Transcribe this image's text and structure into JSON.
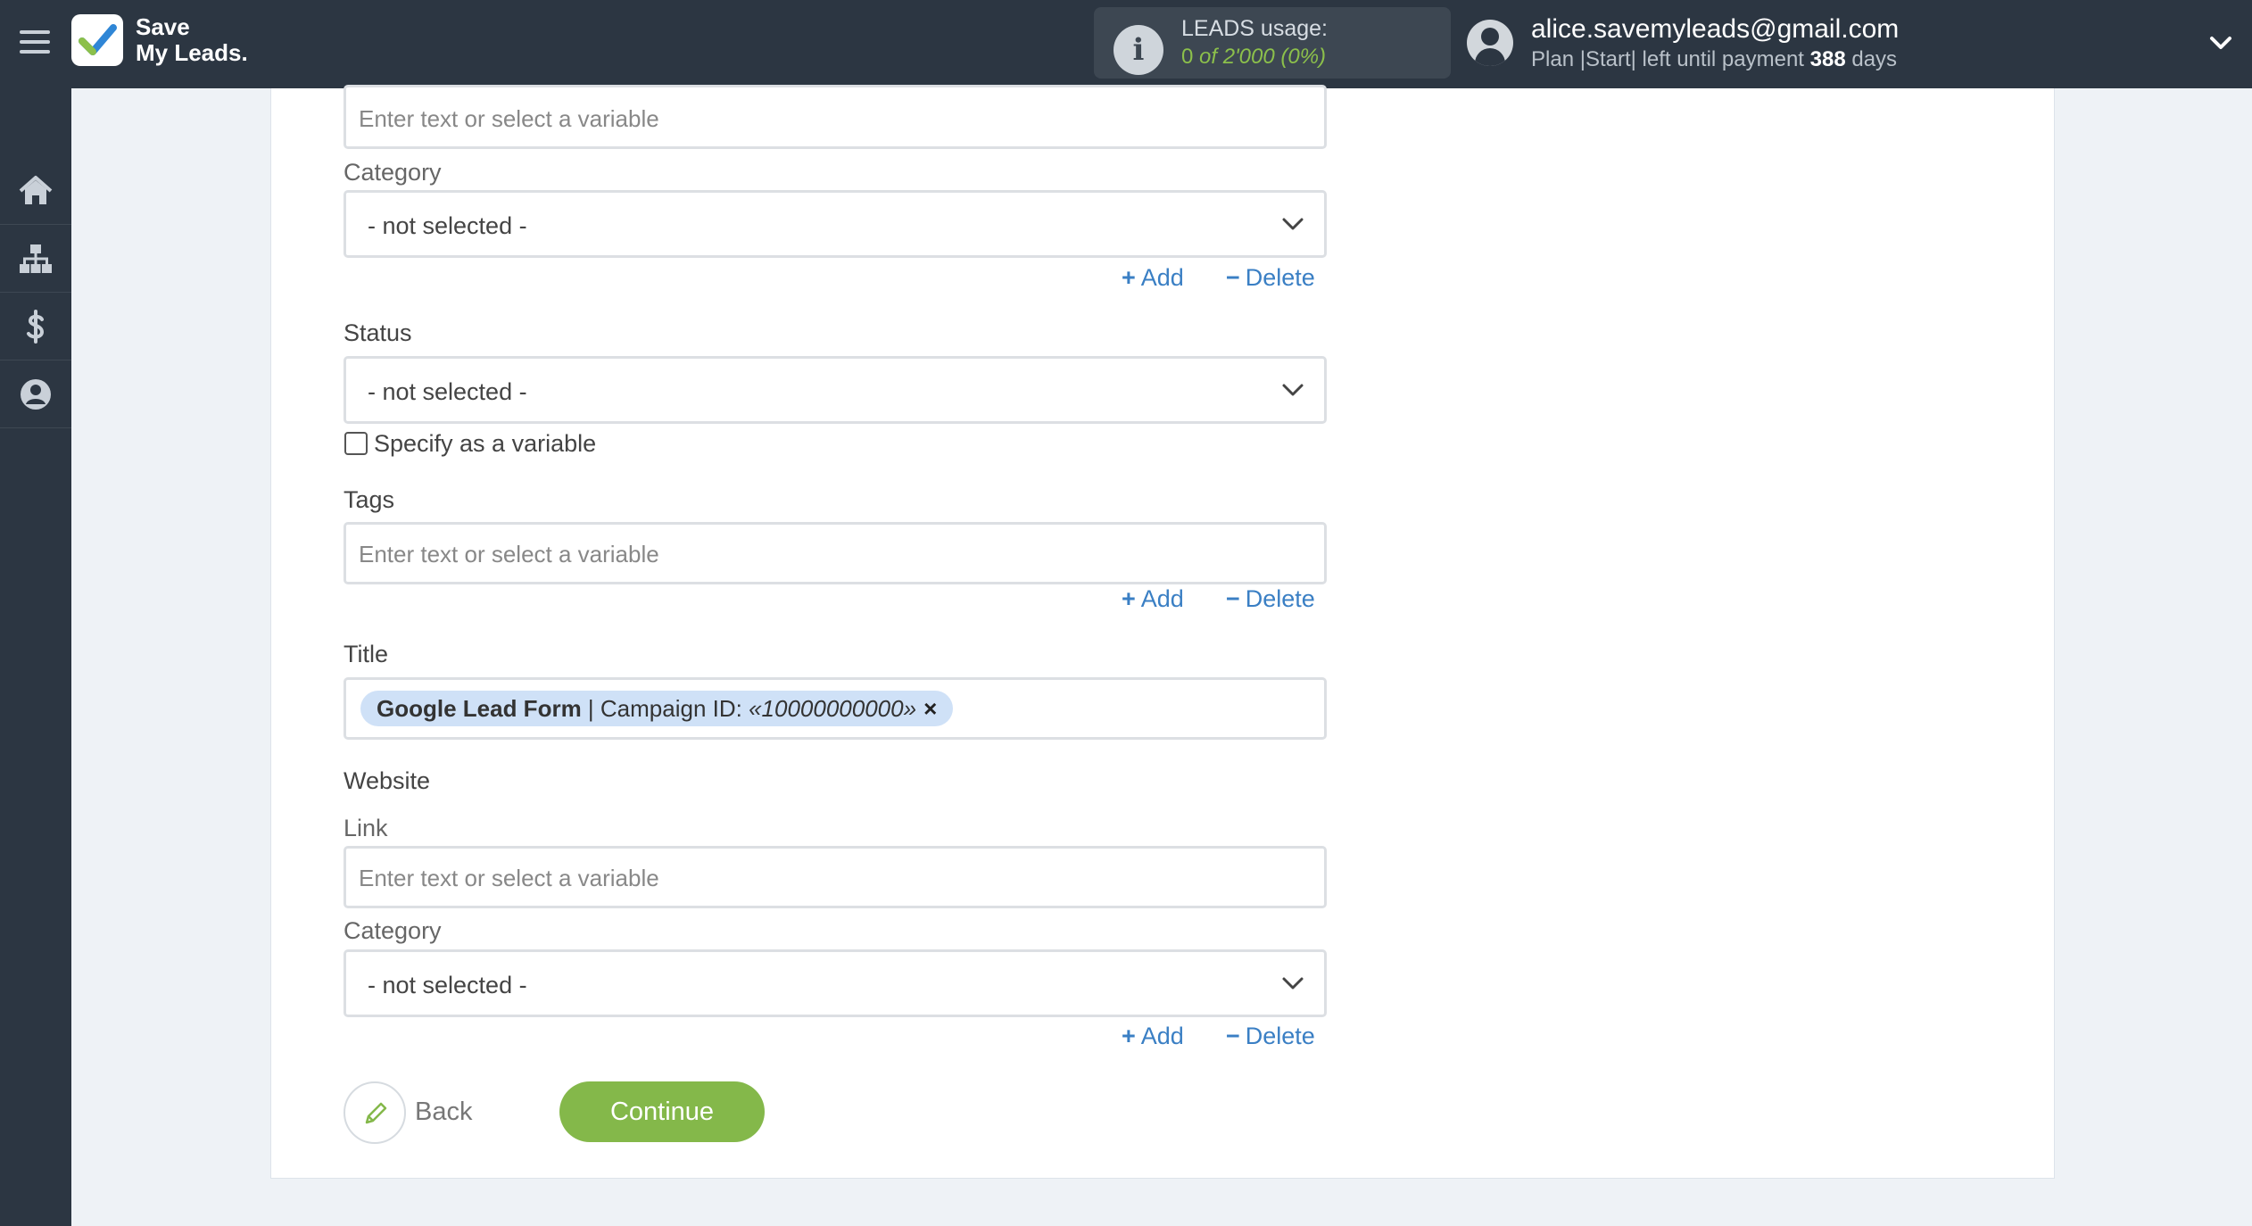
{
  "header": {
    "logo_line1": "Save",
    "logo_line2": "My Leads.",
    "usage_title": "LEADS usage:",
    "usage_used": "0",
    "usage_of": "of 2'000",
    "usage_percent": "(0%)",
    "email": "alice.savemyleads@gmail.com",
    "plan_prefix": "Plan |Start| left until payment",
    "plan_days": "388",
    "plan_suffix": "days"
  },
  "sidebar": {
    "items": [
      {
        "icon": "home-icon"
      },
      {
        "icon": "sitemap-icon"
      },
      {
        "icon": "dollar-icon"
      },
      {
        "icon": "user-icon"
      }
    ]
  },
  "form": {
    "top_input_placeholder": "Enter text or select a variable",
    "category1_label": "Category",
    "category1_value": "- not selected -",
    "add_label": "Add",
    "delete_label": "Delete",
    "status_label": "Status",
    "status_value": "- not selected -",
    "specify_variable_label": "Specify as a variable",
    "tags_label": "Tags",
    "tags_placeholder": "Enter text or select a variable",
    "title_label": "Title",
    "title_tag": {
      "source": "Google Lead Form",
      "separator": " | ",
      "field": "Campaign ID: ",
      "value": "«10000000000»",
      "remove": "×"
    },
    "website_label": "Website",
    "link_label": "Link",
    "link_placeholder": "Enter text or select a variable",
    "category2_label": "Category",
    "category2_value": "- not selected -"
  },
  "footer": {
    "back_label": "Back",
    "continue_label": "Continue"
  },
  "colors": {
    "topbar": "#2c3642",
    "accent_link": "#3a7fc4",
    "continue_button": "#84b84a",
    "usage_value": "#8cc04b",
    "tag_background": "#cfe1f7"
  }
}
